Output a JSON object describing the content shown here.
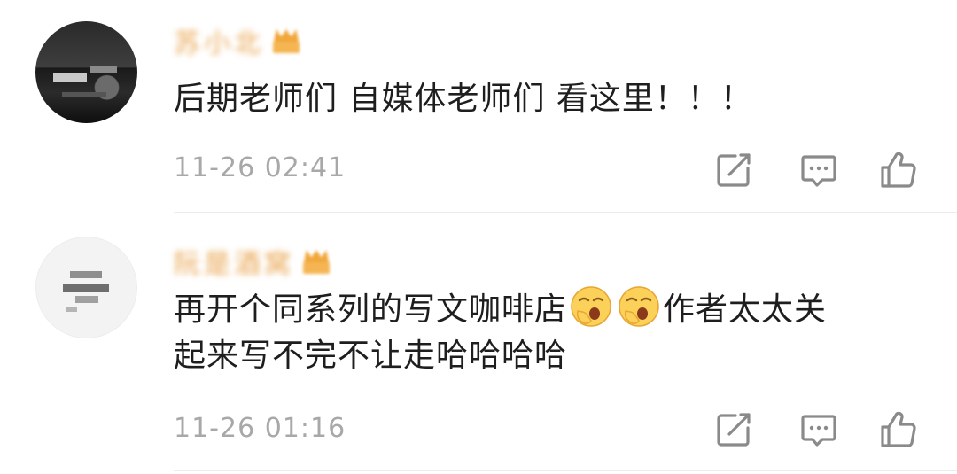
{
  "comments": [
    {
      "username": "苏小北",
      "text": "后期老师们 自媒体老师们 看这里！！！",
      "time": "11-26 02:41",
      "icons": {
        "avatar": "user-avatar",
        "badge": "crown-badge-icon",
        "share": "share-icon",
        "reply": "comment-icon",
        "like": "thumbs-up-icon"
      }
    },
    {
      "username": "阮是酒窝",
      "text_line1_before": "再开个同系列的写文咖啡店",
      "text_line1_after": "作者太太关",
      "text_line2": "起来写不完不让走哈哈哈哈",
      "time": "11-26 01:16",
      "icons": {
        "avatar": "user-avatar",
        "badge": "crown-badge-icon",
        "emoji": "yawn-emoji",
        "share": "share-icon",
        "reply": "comment-icon",
        "like": "thumbs-up-icon"
      }
    }
  ],
  "colors": {
    "text": "#1e1e1e",
    "meta": "#a8a8a8",
    "icon": "#8a8a8a",
    "username": "#e8a24a",
    "divider": "#ececec"
  }
}
